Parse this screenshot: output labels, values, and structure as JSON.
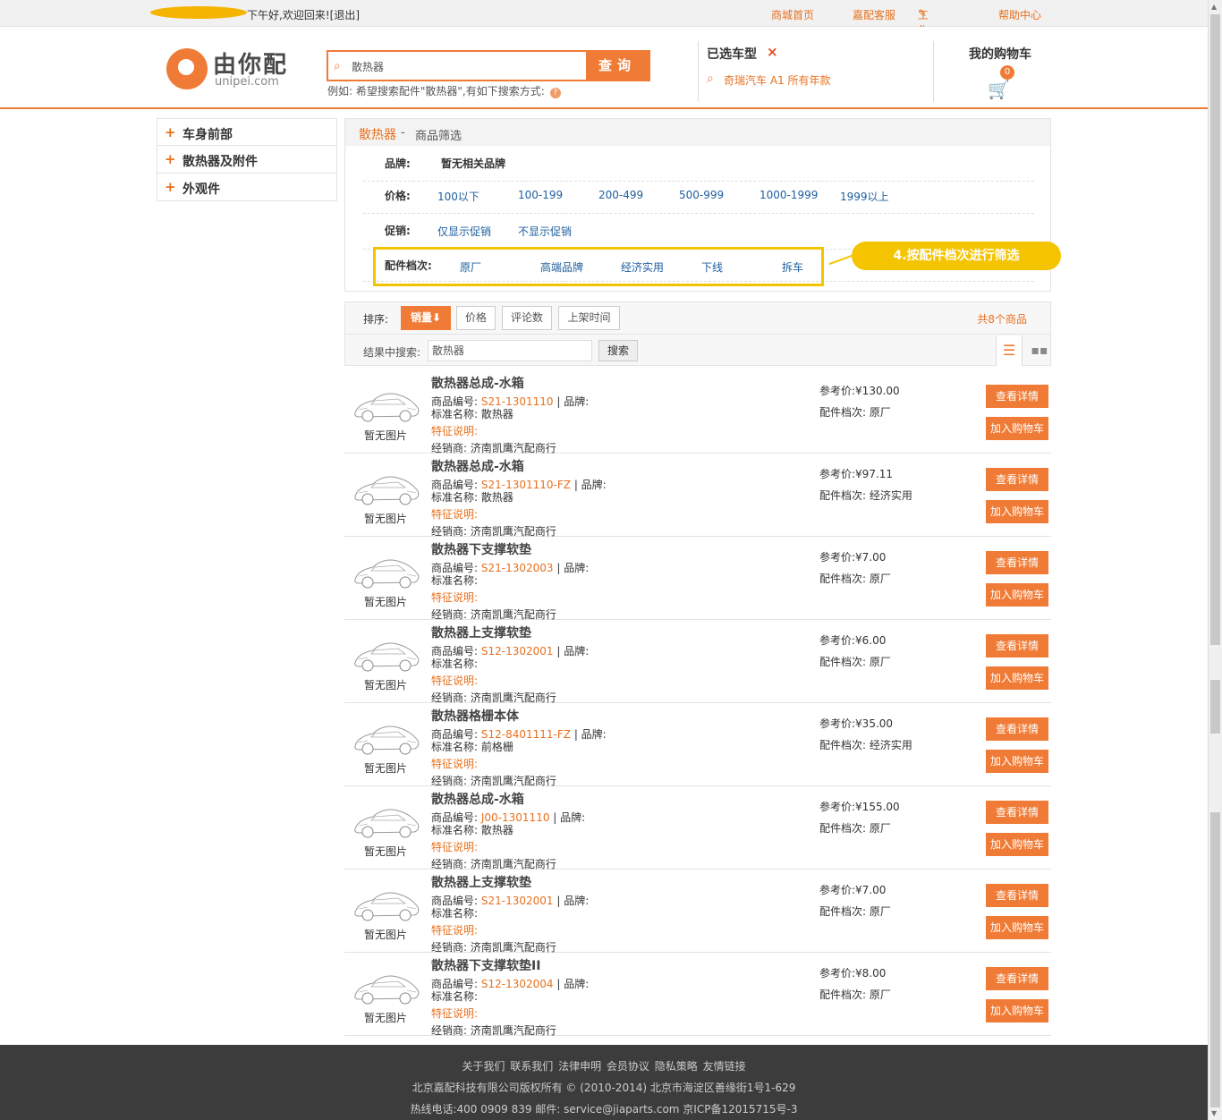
{
  "topbar": {
    "greeting": "下午好,欢迎回来!",
    "logout": "[退出]",
    "links": [
      {
        "label": "商城首页"
      },
      {
        "label": "嘉配客服"
      },
      {
        "label": "工作台"
      },
      {
        "label": "帮助中心"
      }
    ]
  },
  "header": {
    "logo_text": "由你配",
    "logo_sub": "unipei.com",
    "search_value": "散热器",
    "search_button": "查询",
    "search_hint": "例如: 希望搜索配件\"散热器\",有如下搜索方式:",
    "model_title": "已选车型",
    "model_value": "奇瑞汽车 A1 所有年款",
    "cart_title": "我的购物车",
    "cart_count": "0"
  },
  "sidebar": {
    "items": [
      {
        "label": "车身前部"
      },
      {
        "label": "散热器及附件"
      },
      {
        "label": "外观件"
      }
    ]
  },
  "filter": {
    "crumb_main": "散热器",
    "crumb_sep": "-",
    "crumb_sub": "商品筛选",
    "brand_label": "品牌:",
    "brand_value": "暂无相关品牌",
    "price_label": "价格:",
    "prices": [
      "100以下",
      "100-199",
      "200-499",
      "500-999",
      "1000-1999",
      "1999以上"
    ],
    "promo_label": "促销:",
    "promos": [
      "仅显示促销",
      "不显示促销"
    ],
    "grade_label": "配件档次:",
    "grades": [
      "原厂",
      "高端品牌",
      "经济实用",
      "下线",
      "拆车"
    ],
    "callout": "4.按配件档次进行筛选"
  },
  "sort": {
    "label": "排序:",
    "options": [
      "销量⬇",
      "价格",
      "评论数",
      "上架时间"
    ],
    "total": "共8个商品",
    "result_search_label": "结果中搜索:",
    "result_search_value": "散热器",
    "result_search_button": "搜索"
  },
  "product_labels": {
    "no_image": "暂无图片",
    "code": "商品编号:",
    "brand": "| 品牌:",
    "std": "标准名称:",
    "feature": "特征说明:",
    "dealer": "经销商:",
    "price": "参考价:",
    "grade": "配件档次:",
    "detail_btn": "查看详情",
    "cart_btn": "加入购物车"
  },
  "products": [
    {
      "name": "散热器总成-水箱",
      "code": "S21-1301110",
      "std": "散热器",
      "dealer": "济南凯鹰汽配商行",
      "price": "¥130.00",
      "grade": "原厂"
    },
    {
      "name": "散热器总成-水箱",
      "code": "S21-1301110-FZ",
      "std": "散热器",
      "dealer": "济南凯鹰汽配商行",
      "price": "¥97.11",
      "grade": "经济实用"
    },
    {
      "name": "散热器下支撑软垫",
      "code": "S21-1302003",
      "std": "",
      "dealer": "济南凯鹰汽配商行",
      "price": "¥7.00",
      "grade": "原厂"
    },
    {
      "name": "散热器上支撑软垫",
      "code": "S12-1302001",
      "std": "",
      "dealer": "济南凯鹰汽配商行",
      "price": "¥6.00",
      "grade": "原厂"
    },
    {
      "name": "散热器格栅本体",
      "code": "S12-8401111-FZ",
      "std": "前格栅",
      "dealer": "济南凯鹰汽配商行",
      "price": "¥35.00",
      "grade": "经济实用"
    },
    {
      "name": "散热器总成-水箱",
      "code": "J00-1301110",
      "std": "散热器",
      "dealer": "济南凯鹰汽配商行",
      "price": "¥155.00",
      "grade": "原厂"
    },
    {
      "name": "散热器上支撑软垫",
      "code": "S21-1302001",
      "std": "",
      "dealer": "济南凯鹰汽配商行",
      "price": "¥7.00",
      "grade": "原厂"
    },
    {
      "name": "散热器下支撑软垫II",
      "code": "S12-1302004",
      "std": "",
      "dealer": "济南凯鹰汽配商行",
      "price": "¥8.00",
      "grade": "原厂"
    }
  ],
  "footer": {
    "links": [
      "关于我们",
      "联系我们",
      "法律申明",
      "会员协议",
      "隐私策略",
      "友情链接"
    ],
    "copyright": "北京嘉配科技有限公司版权所有 © (2010-2014) 北京市海淀区善缘街1号1-629",
    "contact": "热线电话:400 0909 839    邮件: service@jiaparts.com    京ICP备12015715号-3"
  }
}
